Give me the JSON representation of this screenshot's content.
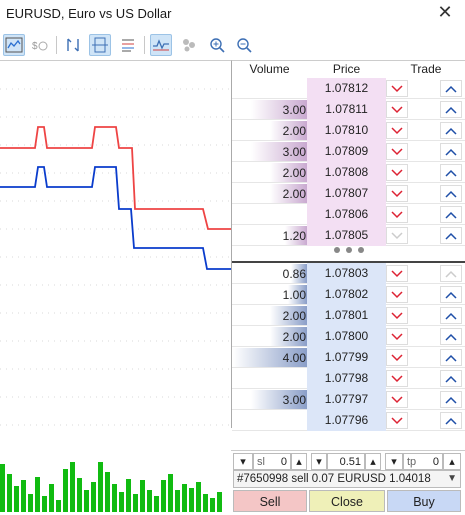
{
  "window": {
    "title": "EURUSD, Euro vs US Dollar",
    "close_glyph": "✕"
  },
  "toolbar": {
    "icons": [
      "chart-icon",
      "ticks-settings-icon",
      "depth-mode-icon",
      "depth-split-icon",
      "depth-list-icon",
      "tick-chart-icon",
      "bubbles-icon",
      "zoom-in-icon",
      "zoom-out-icon"
    ]
  },
  "dom": {
    "headers": {
      "volume": "Volume",
      "price": "Price",
      "trade": "Trade"
    },
    "asks": [
      {
        "volume": "",
        "price": "1.07812"
      },
      {
        "volume": "3.00",
        "price": "1.07811"
      },
      {
        "volume": "2.00",
        "price": "1.07810"
      },
      {
        "volume": "3.00",
        "price": "1.07809"
      },
      {
        "volume": "2.00",
        "price": "1.07808"
      },
      {
        "volume": "2.00",
        "price": "1.07807"
      },
      {
        "volume": "",
        "price": "1.07806"
      },
      {
        "volume": "1.20",
        "price": "1.07805"
      }
    ],
    "bids": [
      {
        "volume": "0.86",
        "price": "1.07803"
      },
      {
        "volume": "1.00",
        "price": "1.07802"
      },
      {
        "volume": "2.00",
        "price": "1.07801"
      },
      {
        "volume": "2.00",
        "price": "1.07800"
      },
      {
        "volume": "4.00",
        "price": "1.07799"
      },
      {
        "volume": "",
        "price": "1.07798"
      },
      {
        "volume": "3.00",
        "price": "1.07797"
      },
      {
        "volume": "",
        "price": "1.07796"
      }
    ]
  },
  "order": {
    "sl_label": "sl",
    "sl_value": "0",
    "lot_value": "0.51",
    "tp_label": "tp",
    "tp_value": "0",
    "position": "#7650998 sell 0.07 EURUSD 1.04018",
    "sell": "Sell",
    "close": "Close",
    "buy": "Buy"
  },
  "colors": {
    "ask_line": "#ee4444",
    "bid_line": "#0a3ccc",
    "volume_bars": "#11bb11",
    "ask_bg": "#f3dff3",
    "bid_bg": "#dce6f8",
    "sell_btn": "#f4c6c6",
    "close_btn": "#eff0b8",
    "buy_btn": "#c8d8f5"
  }
}
